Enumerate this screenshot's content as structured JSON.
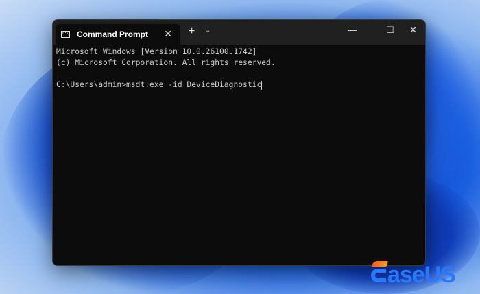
{
  "window": {
    "tab_title": "Command Prompt",
    "tab_icon": "cmd-icon",
    "new_tab": "+",
    "dropdown": "⌄",
    "minimize": "—",
    "maximize": "☐",
    "close": "✕",
    "tab_close": "✕"
  },
  "terminal": {
    "lines": [
      "Microsoft Windows [Version 10.0.26100.1742]",
      "(c) Microsoft Corporation. All rights reserved.",
      "",
      "C:\\Users\\admin>msdt.exe -id DeviceDiagnostic"
    ]
  },
  "watermark": {
    "text": "aseUS",
    "brand": "EaseUS"
  }
}
